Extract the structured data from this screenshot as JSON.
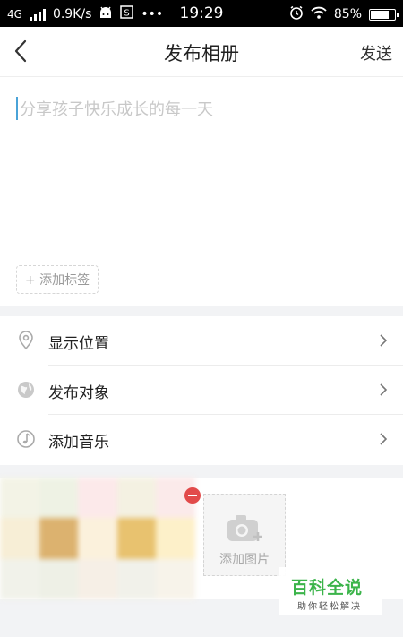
{
  "status_bar": {
    "network": "4G",
    "speed": "0.9K/s",
    "more": "•••",
    "time": "19:29",
    "battery_pct": "85%",
    "battery_level": 0.85
  },
  "header": {
    "title": "发布相册",
    "send_label": "发送"
  },
  "composer": {
    "placeholder": "分享孩子快乐成长的每一天",
    "tag_button": "+ 添加标签"
  },
  "options": [
    {
      "label": "显示位置",
      "icon": "location-pin-icon"
    },
    {
      "label": "发布对象",
      "icon": "globe-icon"
    },
    {
      "label": "添加音乐",
      "icon": "music-note-icon"
    }
  ],
  "photos": {
    "add_label": "添加图片"
  },
  "watermark": {
    "title": "百科全说",
    "subtitle": "助你轻松解决"
  },
  "colors": {
    "accent_cursor": "#4aa3d8",
    "remove_badge": "#e24a4a",
    "watermark_green": "#3bb44a"
  }
}
